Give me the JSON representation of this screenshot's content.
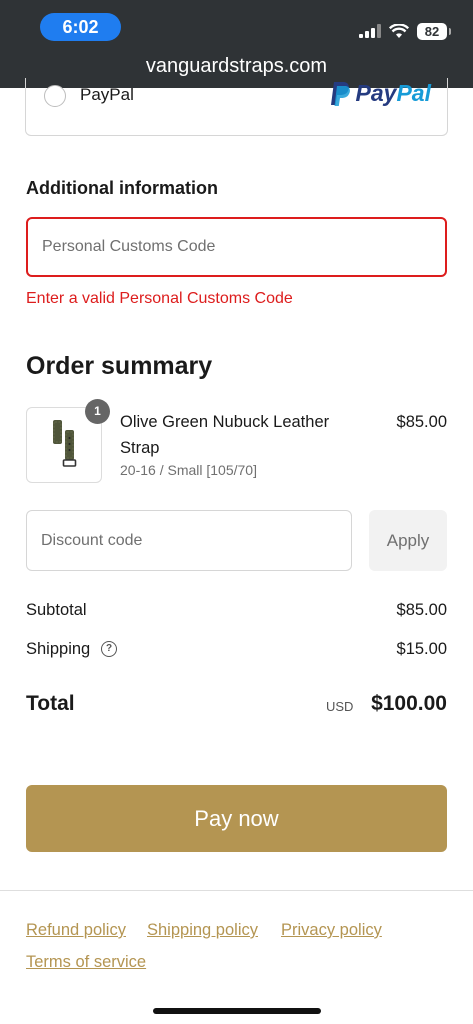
{
  "status_bar": {
    "time": "6:02",
    "battery": "82",
    "url": "vanguardstraps.com"
  },
  "payment": {
    "paypal_label": "PayPal",
    "paypal_logo_a": "Pay",
    "paypal_logo_b": "Pal"
  },
  "additional_info": {
    "title": "Additional information",
    "customs_placeholder": "Personal Customs Code",
    "customs_value": "",
    "error": "Enter a valid Personal Customs Code"
  },
  "order_summary": {
    "title": "Order summary",
    "item": {
      "quantity": "1",
      "name": "Olive Green Nubuck Leather Strap",
      "variant": "20-16 / Small [105/70]",
      "price": "$85.00"
    },
    "discount_placeholder": "Discount code",
    "apply_label": "Apply",
    "subtotal_label": "Subtotal",
    "subtotal_value": "$85.00",
    "shipping_label": "Shipping",
    "shipping_value": "$15.00",
    "total_label": "Total",
    "currency": "USD",
    "total_value": "$100.00"
  },
  "pay_now_label": "Pay now",
  "footer": {
    "refund": "Refund policy",
    "shipping": "Shipping policy",
    "privacy": "Privacy policy",
    "terms": "Terms of service"
  },
  "colors": {
    "accent": "#b49552",
    "error": "#dd1d1d",
    "status_bar": "#2f3336",
    "time_pill": "#1f7df0"
  }
}
